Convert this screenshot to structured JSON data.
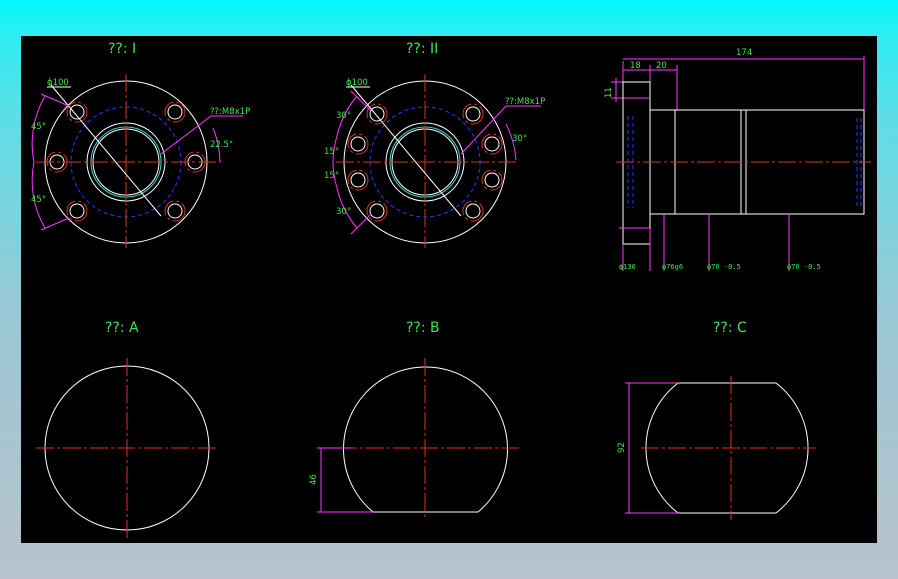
{
  "views": {
    "view1_title": "??: I",
    "view2_title": "??: II",
    "viewA_title": "??: A",
    "viewB_title": "??: B",
    "viewC_title": "??: C"
  },
  "dimensions": {
    "v1_phi": "ϕ100",
    "v1_thread": "??:M8x1P",
    "v1_angle_top": "45°",
    "v1_angle_bottom": "45°",
    "v1_angle_small": "22.5°",
    "v2_phi": "ϕ100",
    "v2_thread": "??:M8x1P",
    "v2_angle_30a": "30°",
    "v2_angle_15a": "15°",
    "v2_angle_15b": "15°",
    "v2_angle_30b": "30°",
    "v2_angle_right": "30°",
    "side_total": "174",
    "side_18": "18",
    "side_20": "20",
    "side_11": "11",
    "side_phi1": "ϕ130",
    "side_phi2": "ϕ76g6",
    "side_phi3": "ϕ70 -0.5",
    "side_phi4": "ϕ70 -0.5",
    "viewB_height": "46",
    "viewC_height": "92"
  },
  "colors": {
    "background": "#000000",
    "outline": "#ffffff",
    "centerline": "#e0301e",
    "hidden": "#2a38ff",
    "dimension": "#ff33ff",
    "text": "#41e24d"
  }
}
